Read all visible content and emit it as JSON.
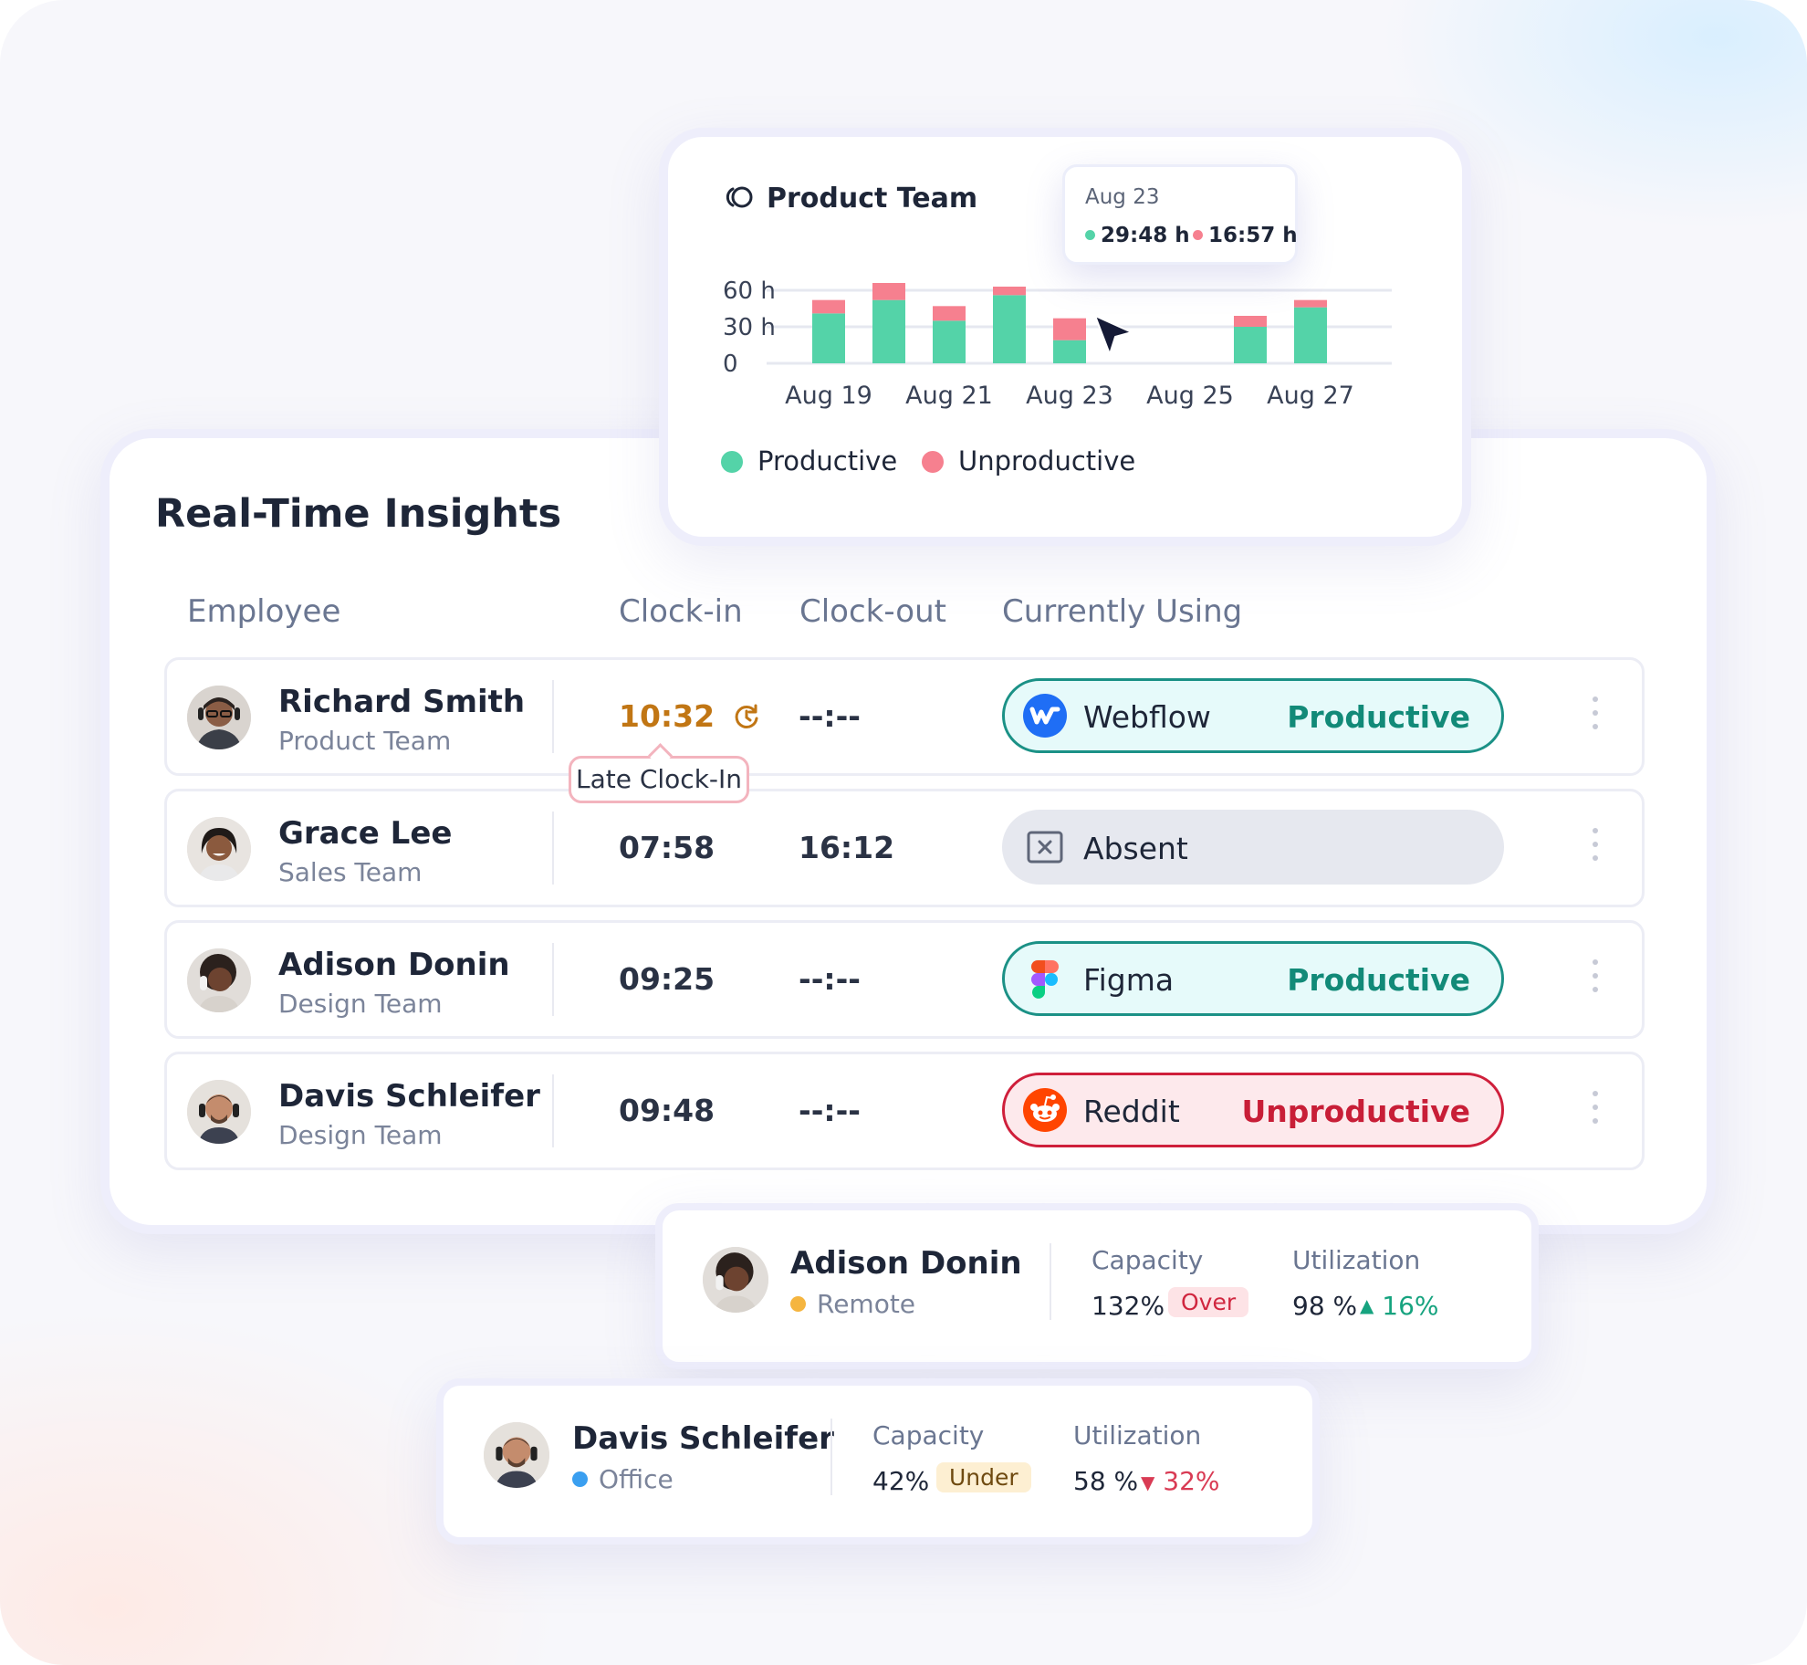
{
  "colors": {
    "productive": "#54d3a8",
    "unproductive": "#f6808f",
    "productive_text": "#128a78",
    "unproductive_text": "#c81e37",
    "late": "#c17614"
  },
  "chart_card": {
    "title": "Product Team",
    "icon": "loop-icon",
    "tooltip": {
      "date": "Aug 23",
      "productive": "29:48 h",
      "unproductive": "16:57 h"
    },
    "legend": [
      "Productive",
      "Unproductive"
    ]
  },
  "chart_data": {
    "type": "bar",
    "stacked": true,
    "categories": [
      "Aug 19",
      "Aug 20",
      "Aug 21",
      "Aug 22",
      "Aug 23",
      "Aug 24",
      "Aug 25",
      "Aug 26",
      "Aug 27"
    ],
    "x_tick_labels": [
      "Aug 19",
      "Aug 21",
      "Aug 23",
      "Aug 25",
      "Aug 27"
    ],
    "y_tick_labels": [
      "60 h",
      "30 h",
      "0"
    ],
    "y_ticks": [
      60,
      30,
      0
    ],
    "ylim": [
      0,
      72
    ],
    "series": [
      {
        "name": "Productive",
        "color": "#54d3a8",
        "values": [
          41,
          52,
          35,
          56,
          19,
          0,
          0,
          30,
          46
        ]
      },
      {
        "name": "Unproductive",
        "color": "#f6808f",
        "values": [
          11,
          14,
          12,
          7,
          18,
          0,
          0,
          9,
          6
        ]
      }
    ],
    "grid": true,
    "legend_position": "bottom-left",
    "highlighted_category": "Aug 23"
  },
  "main": {
    "title": "Real-Time Insights",
    "columns": [
      "Employee",
      "Clock-in",
      "Clock-out",
      "Currently Using"
    ],
    "late_tooltip": "Late Clock-In",
    "rows": [
      {
        "name": "Richard Smith",
        "team": "Product Team",
        "clock_in": "10:32",
        "clock_out": "--:--",
        "app": "Webflow",
        "status": "Productive",
        "late": true
      },
      {
        "name": "Grace Lee",
        "team": "Sales Team",
        "clock_in": "07:58",
        "clock_out": "16:12",
        "app": "Absent",
        "status": ""
      },
      {
        "name": "Adison Donin",
        "team": "Design Team",
        "clock_in": "09:25",
        "clock_out": "--:--",
        "app": "Figma",
        "status": "Productive"
      },
      {
        "name": "Davis Schleifer",
        "team": "Design Team",
        "clock_in": "09:48",
        "clock_out": "--:--",
        "app": "Reddit",
        "status": "Unproductive"
      }
    ]
  },
  "details": [
    {
      "name": "Adison Donin",
      "location": "Remote",
      "location_color": "#f5b53f",
      "capacity_label": "Capacity",
      "capacity": "132%",
      "capacity_badge": "Over",
      "utilization_label": "Utilization",
      "utilization": "98 %",
      "trend": "16%",
      "trend_dir": "up"
    },
    {
      "name": "Davis Schleifer",
      "location": "Office",
      "location_color": "#3a9ff0",
      "capacity_label": "Capacity",
      "capacity": "42%",
      "capacity_badge": "Under",
      "utilization_label": "Utilization",
      "utilization": "58 %",
      "trend": "32%",
      "trend_dir": "down"
    }
  ]
}
